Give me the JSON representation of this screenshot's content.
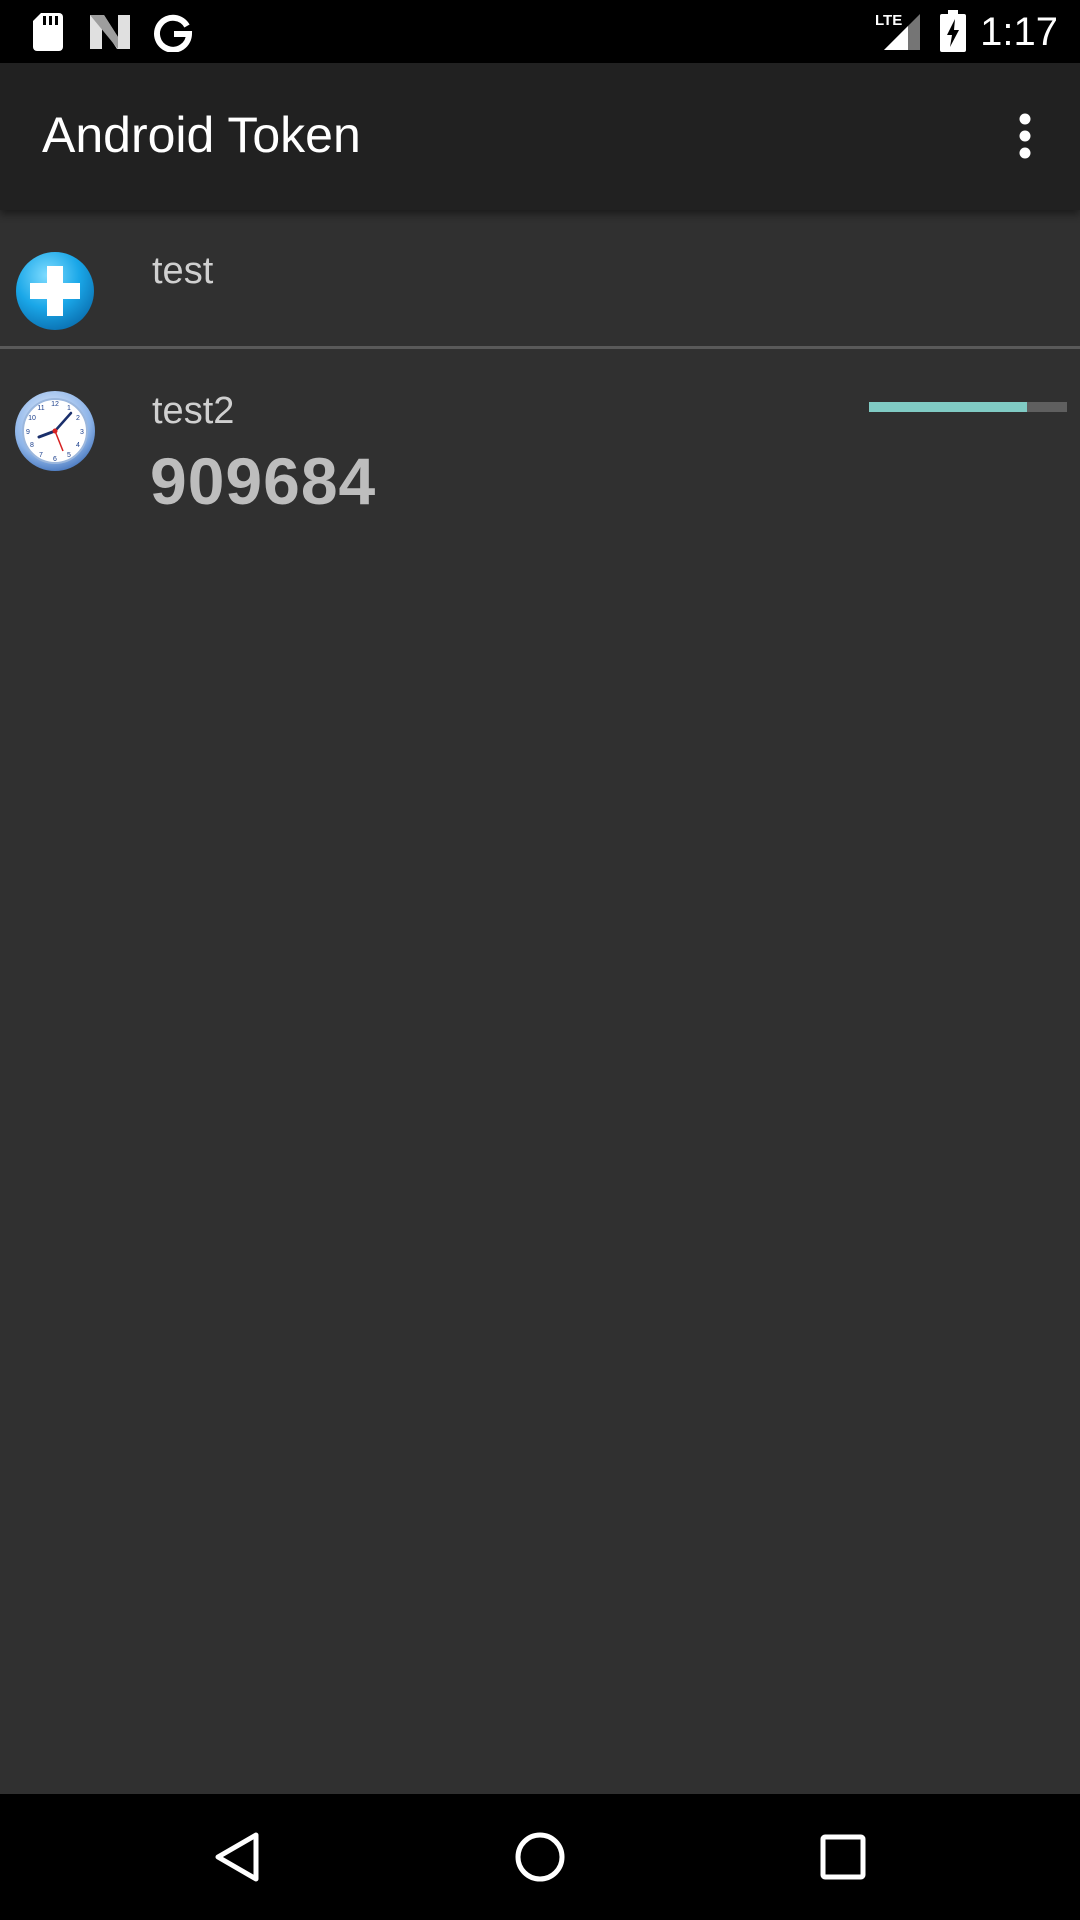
{
  "status_bar": {
    "time": "1:17",
    "network": "LTE",
    "left_icons": [
      "sd-card-icon",
      "n-logo-icon",
      "google-g-icon"
    ],
    "right_icons": [
      "lte-signal-icon",
      "battery-charging-icon"
    ]
  },
  "app_bar": {
    "title": "Android Token",
    "overflow_icon": "more-vert-icon"
  },
  "tokens": [
    {
      "name": "test",
      "icon": "add-plus-icon",
      "type": "counter"
    },
    {
      "name": "test2",
      "code": "909684",
      "icon": "clock-icon",
      "type": "time",
      "time_remaining_fraction": 0.8
    }
  ],
  "nav_bar": {
    "buttons": [
      "back-icon",
      "home-icon",
      "recents-icon"
    ]
  },
  "colors": {
    "background": "#303030",
    "app_bar": "#212121",
    "accent": "#80cbc4",
    "divider": "#595959"
  }
}
